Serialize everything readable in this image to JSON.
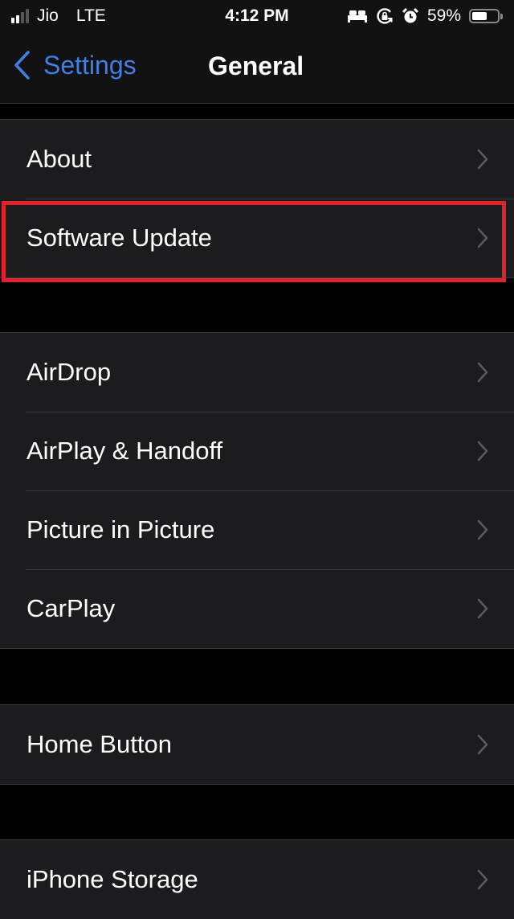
{
  "status_bar": {
    "carrier": "Jio",
    "network": "LTE",
    "time": "4:12 PM",
    "signal_bars_active": 2,
    "signal_bars_total": 4,
    "icons": [
      "bed-icon",
      "orientation-lock-icon",
      "alarm-icon"
    ],
    "battery_percent_label": "59%",
    "battery_level": 0.59
  },
  "nav": {
    "back_label": "Settings",
    "title": "General",
    "accent_color": "#3f7fe6"
  },
  "groups": [
    {
      "items": [
        {
          "label": "About"
        },
        {
          "label": "Software Update",
          "highlighted": true
        }
      ]
    },
    {
      "items": [
        {
          "label": "AirDrop"
        },
        {
          "label": "AirPlay & Handoff"
        },
        {
          "label": "Picture in Picture"
        },
        {
          "label": "CarPlay"
        }
      ]
    },
    {
      "items": [
        {
          "label": "Home Button"
        }
      ]
    },
    {
      "items": [
        {
          "label": "iPhone Storage"
        }
      ]
    }
  ],
  "highlight": {
    "target": "Software Update",
    "color": "#e0242b"
  }
}
